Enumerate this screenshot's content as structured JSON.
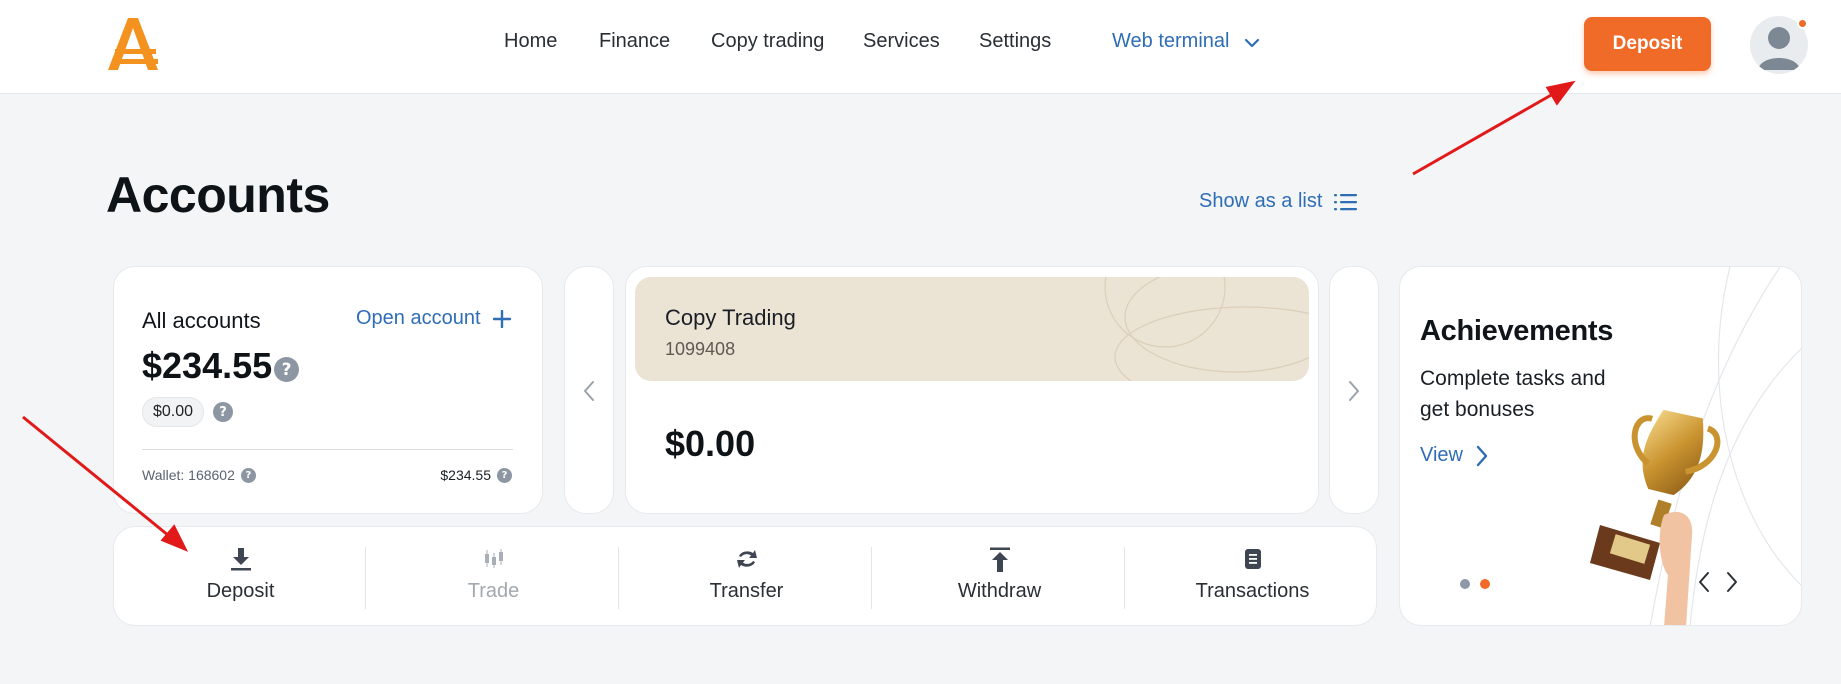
{
  "header": {
    "nav": [
      "Home",
      "Finance",
      "Copy trading",
      "Services",
      "Settings"
    ],
    "web_terminal": "Web terminal",
    "deposit_label": "Deposit"
  },
  "page": {
    "title": "Accounts",
    "show_as_list": "Show as a list"
  },
  "all_accounts": {
    "title": "All accounts",
    "open_account": "Open account",
    "total": "$234.55",
    "secondary": "$0.00",
    "wallet_label": "Wallet: 168602",
    "wallet_amount": "$234.55"
  },
  "copy_trading": {
    "title": "Copy Trading",
    "number": "1099408",
    "balance": "$0.00"
  },
  "actions": [
    {
      "label": "Deposit",
      "icon": "download-icon",
      "enabled": true
    },
    {
      "label": "Trade",
      "icon": "candlestick-icon",
      "enabled": false
    },
    {
      "label": "Transfer",
      "icon": "transfer-icon",
      "enabled": true
    },
    {
      "label": "Withdraw",
      "icon": "upload-icon",
      "enabled": true
    },
    {
      "label": "Transactions",
      "icon": "document-icon",
      "enabled": true
    }
  ],
  "achievements": {
    "title": "Achievements",
    "description": "Complete tasks and get bonuses",
    "view": "View"
  },
  "colors": {
    "accent": "#f06a28",
    "link": "#2f6db5",
    "annotation_arrow": "#e11919"
  }
}
